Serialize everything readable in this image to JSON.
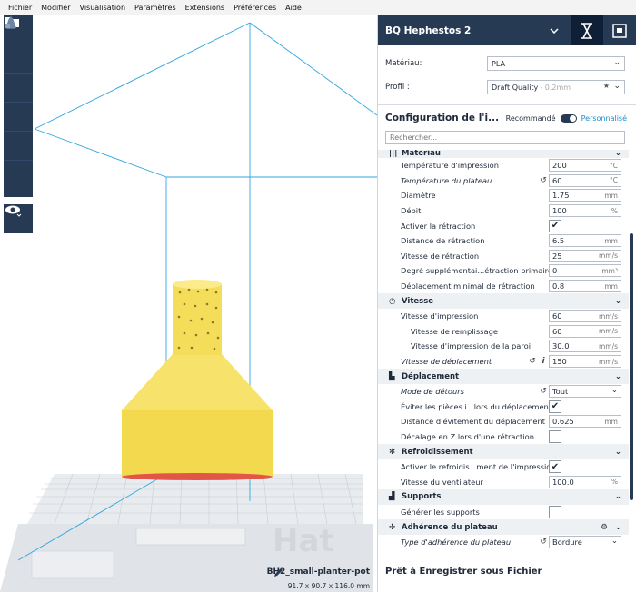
{
  "menu": [
    "Fichier",
    "Modifier",
    "Visualisation",
    "Paramètres",
    "Extensions",
    "Préférences",
    "Aide"
  ],
  "printer": {
    "name": "BQ Hephestos 2"
  },
  "material": {
    "label": "Matériau:",
    "value": "PLA"
  },
  "profile": {
    "label": "Profil :",
    "value": "Draft Quality",
    "hint": "- 0.2mm"
  },
  "config": {
    "title": "Configuration de l'i...",
    "recommended": "Recommandé",
    "custom": "Personnalisé"
  },
  "search": {
    "placeholder": "Rechercher..."
  },
  "categories": {
    "materiau": "Matériau",
    "vitesse": "Vitesse",
    "deplacement": "Déplacement",
    "refroidissement": "Refroidissement",
    "supports": "Supports",
    "adherence": "Adhérence du plateau"
  },
  "settings": {
    "print_temp": {
      "label": "Température d'impression",
      "value": "200",
      "unit": "°C"
    },
    "bed_temp": {
      "label": "Température du plateau",
      "value": "60",
      "unit": "°C"
    },
    "diameter": {
      "label": "Diamètre",
      "value": "1.75",
      "unit": "mm"
    },
    "flow": {
      "label": "Débit",
      "value": "100",
      "unit": "%"
    },
    "retraction_enable": {
      "label": "Activer la rétraction"
    },
    "retraction_dist": {
      "label": "Distance de rétraction",
      "value": "6.5",
      "unit": "mm"
    },
    "retraction_speed": {
      "label": "Vitesse de rétraction",
      "value": "25",
      "unit": "mm/s"
    },
    "retraction_extra": {
      "label": "Degré supplémentai...étraction primaire",
      "value": "0",
      "unit": "mm³"
    },
    "retraction_min": {
      "label": "Déplacement minimal de rétraction",
      "value": "0.8",
      "unit": "mm"
    },
    "print_speed": {
      "label": "Vitesse d'impression",
      "value": "60",
      "unit": "mm/s"
    },
    "infill_speed": {
      "label": "Vitesse de remplissage",
      "value": "60",
      "unit": "mm/s"
    },
    "wall_speed": {
      "label": "Vitesse d'impression de la paroi",
      "value": "30.0",
      "unit": "mm/s"
    },
    "travel_speed": {
      "label": "Vitesse de déplacement",
      "value": "150",
      "unit": "mm/s"
    },
    "combing": {
      "label": "Mode de détours",
      "value": "Tout"
    },
    "avoid_parts": {
      "label": "Éviter les pièces i...lors du déplacement"
    },
    "avoid_dist": {
      "label": "Distance d'évitement du déplacement",
      "value": "0.625",
      "unit": "mm"
    },
    "z_hop": {
      "label": "Décalage en Z lors d'une rétraction"
    },
    "cooling_enable": {
      "label": "Activer le refroidis...ment de l'impression"
    },
    "fan_speed": {
      "label": "Vitesse du ventilateur",
      "value": "100.0",
      "unit": "%"
    },
    "supports_gen": {
      "label": "Générer les supports"
    },
    "adhesion_type": {
      "label": "Type d'adhérence du plateau",
      "value": "Bordure"
    }
  },
  "footer": {
    "title": "Prêt à Enregistrer sous Fichier"
  },
  "object": {
    "name": "BH2_small-planter-pot",
    "dims": "91.7 x 90.7 x 116.0 mm"
  },
  "icons": {
    "check": "✔",
    "reset": "↺",
    "info": "i",
    "chevron": "⌄",
    "star": "★",
    "gear": "⚙"
  },
  "colors": {
    "accent": "#1e8fc8",
    "dark": "#273a54",
    "model": "#f7e36c",
    "volume": "#2fa7e0"
  }
}
